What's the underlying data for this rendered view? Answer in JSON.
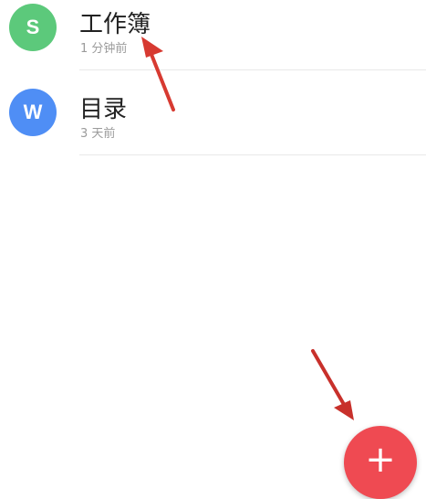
{
  "files": [
    {
      "avatar_letter": "S",
      "avatar_color": "#5cc97b",
      "title": "工作簿",
      "time": "1 分钟前"
    },
    {
      "avatar_letter": "W",
      "avatar_color": "#4f8ef5",
      "title": "目录",
      "time": "3 天前"
    }
  ],
  "fab": {
    "label": "+",
    "color": "#ef4a52"
  },
  "annotation_color": "#d73a31"
}
